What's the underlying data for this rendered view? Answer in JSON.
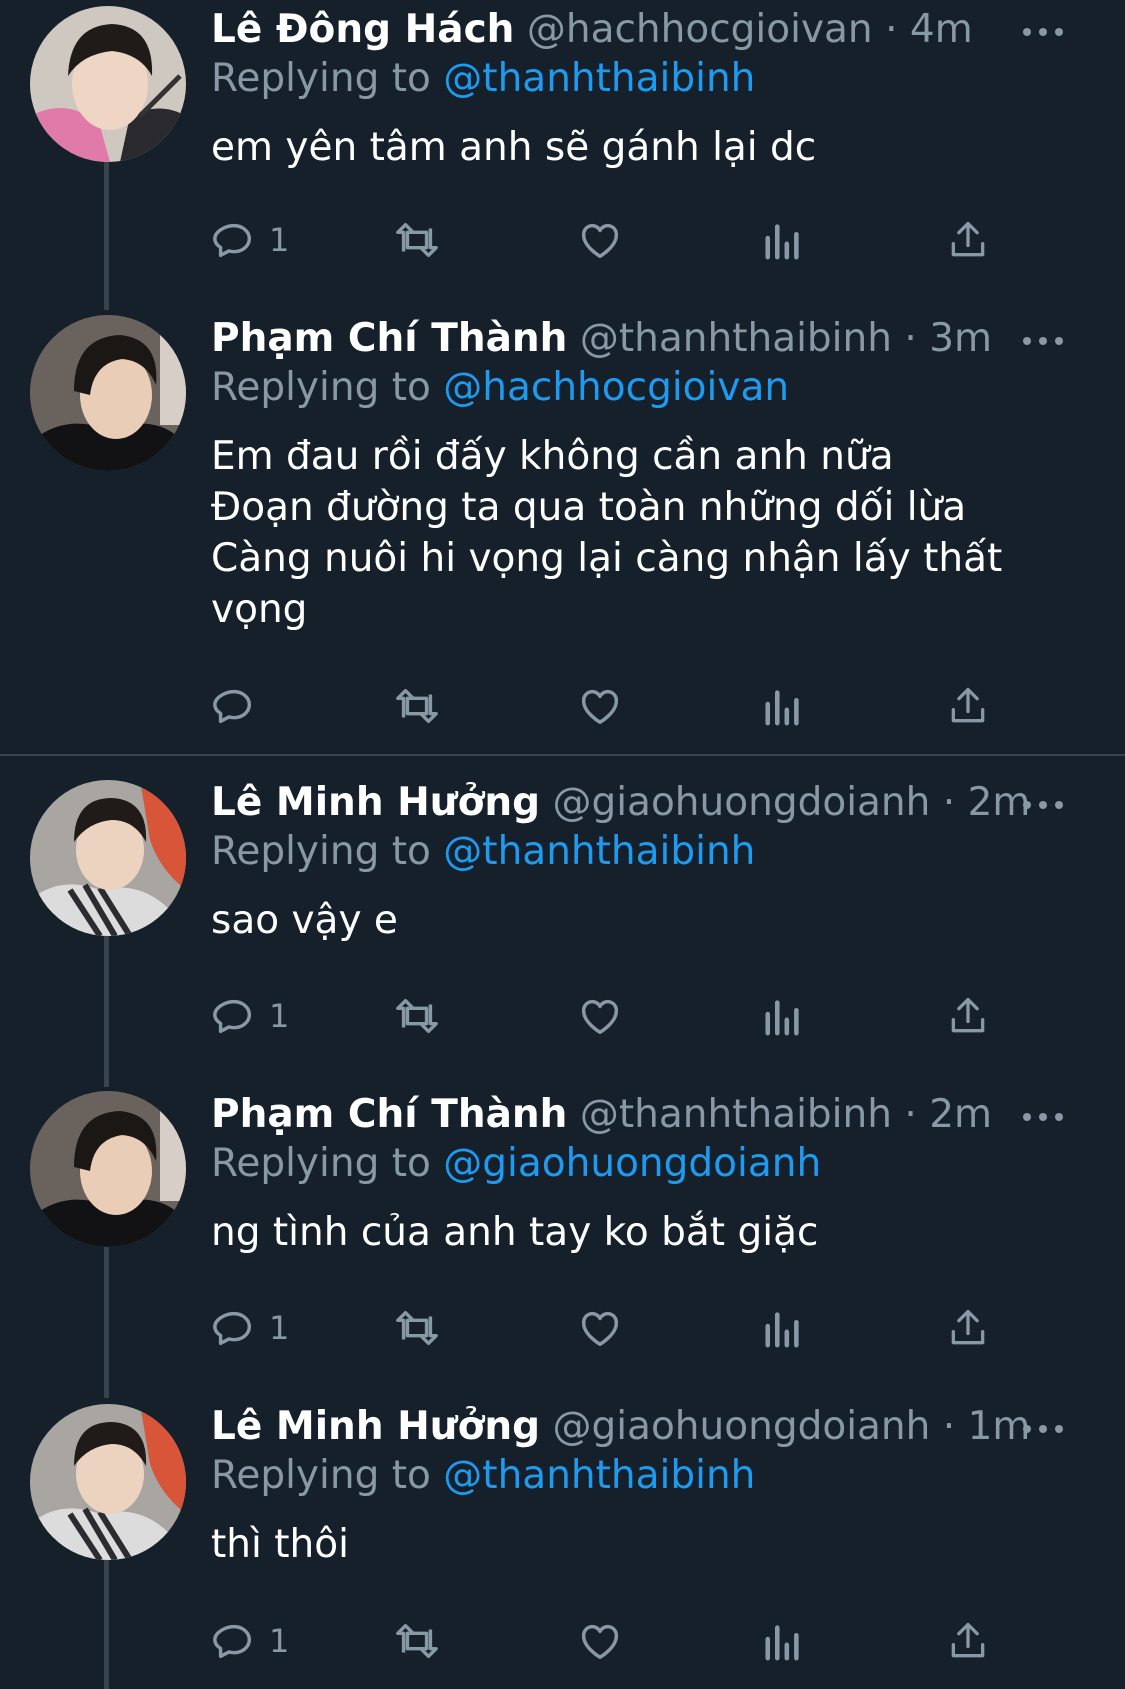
{
  "tweets": [
    {
      "name": "Lê Đông Hách",
      "handle": "@hachhocgioivan",
      "time": "4m",
      "replying_prefix": "Replying to",
      "replying_to": "@thanhthaibinh",
      "lines": [
        "em yên tâm anh sẽ gánh lại dc"
      ],
      "reply_count": "1",
      "avatar": "avatar-pink-hoodie"
    },
    {
      "name": "Phạm Chí Thành",
      "handle": "@thanhthaibinh",
      "time": "3m",
      "replying_prefix": "Replying to",
      "replying_to": "@hachhocgioivan",
      "lines": [
        "Em đau rồi đấy không cần anh nữa",
        "Đoạn đường ta qua toàn những dối lừa",
        "Càng nuôi hi vọng lại càng nhận lấy thất",
        "vọng"
      ],
      "reply_count": "",
      "avatar": "avatar-dark-hair"
    },
    {
      "name": "Lê Minh Hưởng",
      "handle": "@giaohuongdoianh",
      "time": "2m",
      "replying_prefix": "Replying to",
      "replying_to": "@thanhthaibinh",
      "lines": [
        "sao vậy e"
      ],
      "reply_count": "1",
      "avatar": "avatar-striped-scarf"
    },
    {
      "name": "Phạm Chí Thành",
      "handle": "@thanhthaibinh",
      "time": "2m",
      "replying_prefix": "Replying to",
      "replying_to": "@giaohuongdoianh",
      "lines": [
        "ng tình của anh tay ko bắt giặc"
      ],
      "reply_count": "1",
      "avatar": "avatar-dark-hair"
    },
    {
      "name": "Lê Minh Hưởng",
      "handle": "@giaohuongdoianh",
      "time": "1m",
      "replying_prefix": "Replying to",
      "replying_to": "@thanhthaibinh",
      "lines": [
        "thì thôi"
      ],
      "reply_count": "1",
      "avatar": "avatar-striped-scarf"
    }
  ],
  "icons": {
    "reply": "reply-icon",
    "retweet": "retweet-icon",
    "like": "heart-icon",
    "analytics": "analytics-icon",
    "share": "share-icon",
    "more": "more-options-icon"
  },
  "colors": {
    "background": "#15202b",
    "text": "#ffffff",
    "secondary": "#8899a6",
    "mention": "#1d9bf0",
    "divider": "#38444d"
  }
}
